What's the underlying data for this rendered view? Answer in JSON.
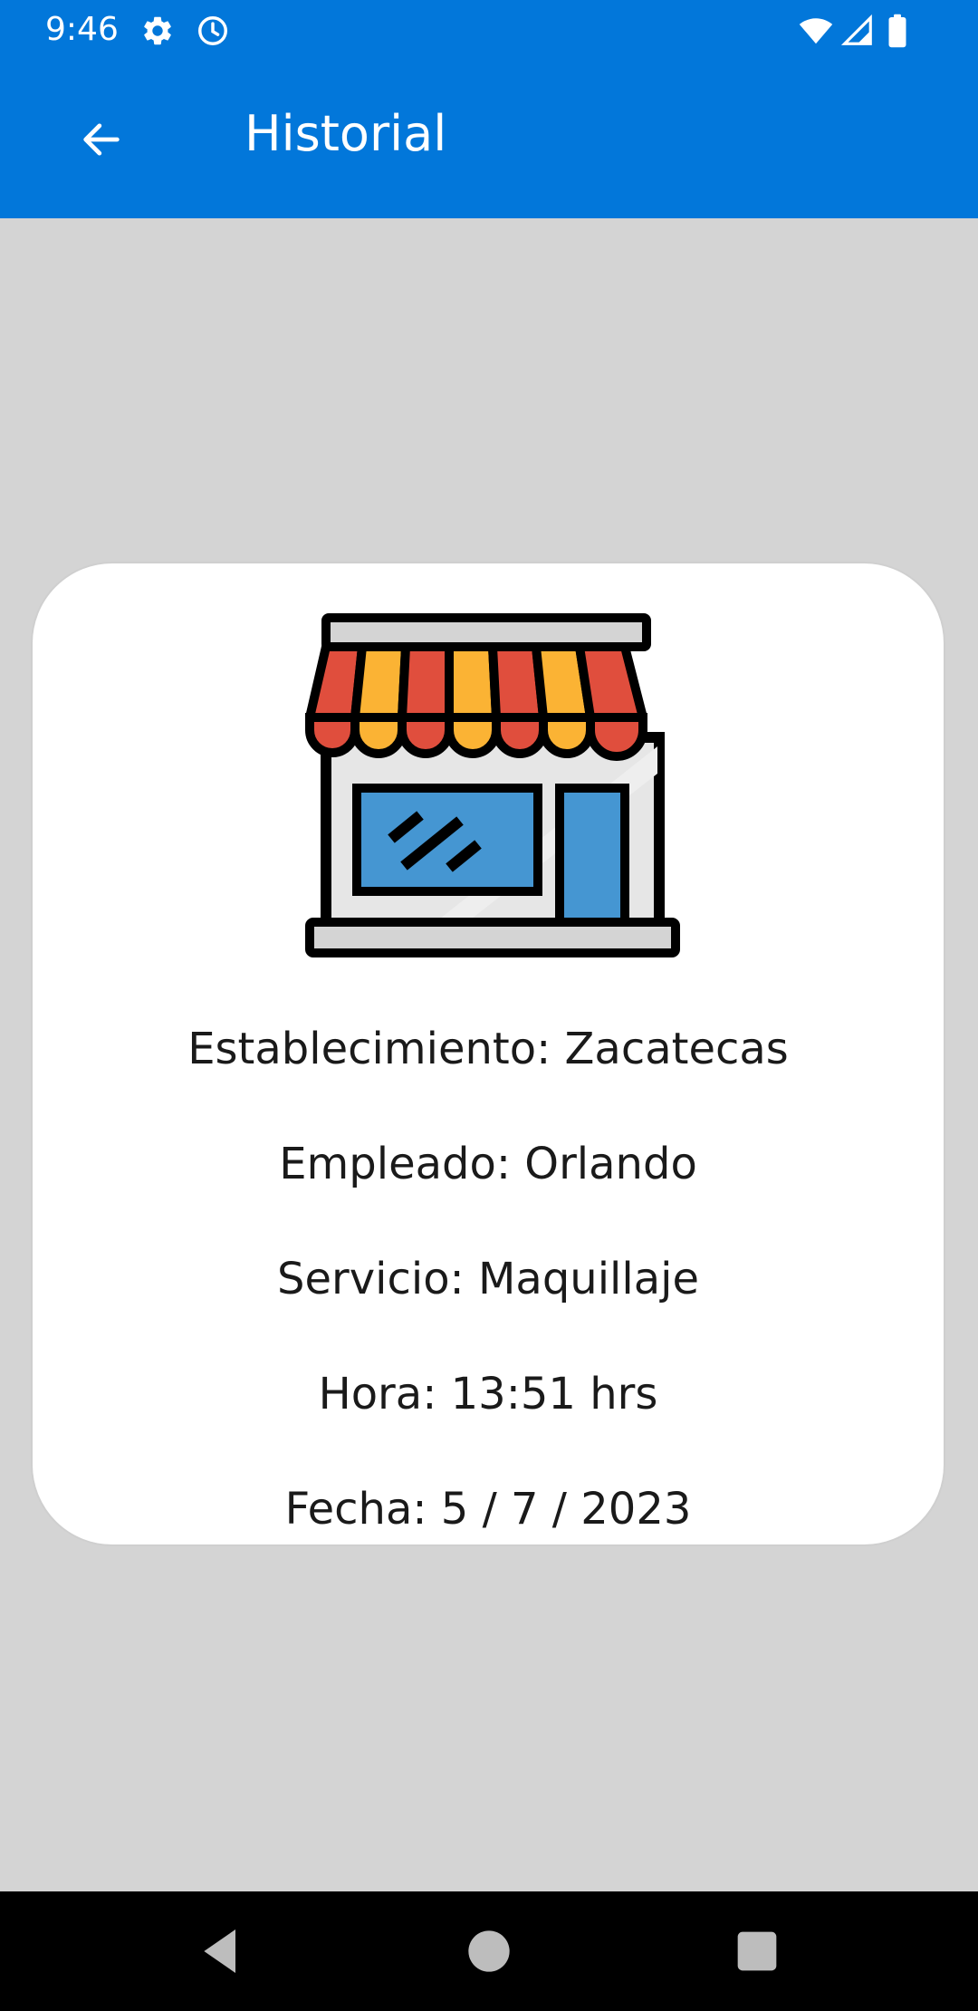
{
  "status_bar": {
    "time": "9:46",
    "icons": [
      "settings-icon",
      "alarm-icon",
      "wifi-icon",
      "cellular-icon",
      "battery-icon"
    ]
  },
  "app_bar": {
    "title": "Historial",
    "back_icon": "arrow-back-icon",
    "color": "#0277da"
  },
  "card": {
    "icon": "storefront-icon",
    "lines": [
      "Establecimiento: Zacatecas",
      "Empleado: Orlando",
      "Servicio: Maquillaje",
      "Hora: 13:51 hrs",
      "Fecha: 5 / 7 / 2023"
    ]
  },
  "nav_bar": {
    "icons": [
      "back-triangle-icon",
      "home-circle-icon",
      "recents-square-icon"
    ]
  },
  "colors": {
    "background": "#d4d4d4",
    "awning_red": "#e04e3d",
    "awning_yellow": "#fbb334",
    "window_blue": "#4596d2"
  }
}
